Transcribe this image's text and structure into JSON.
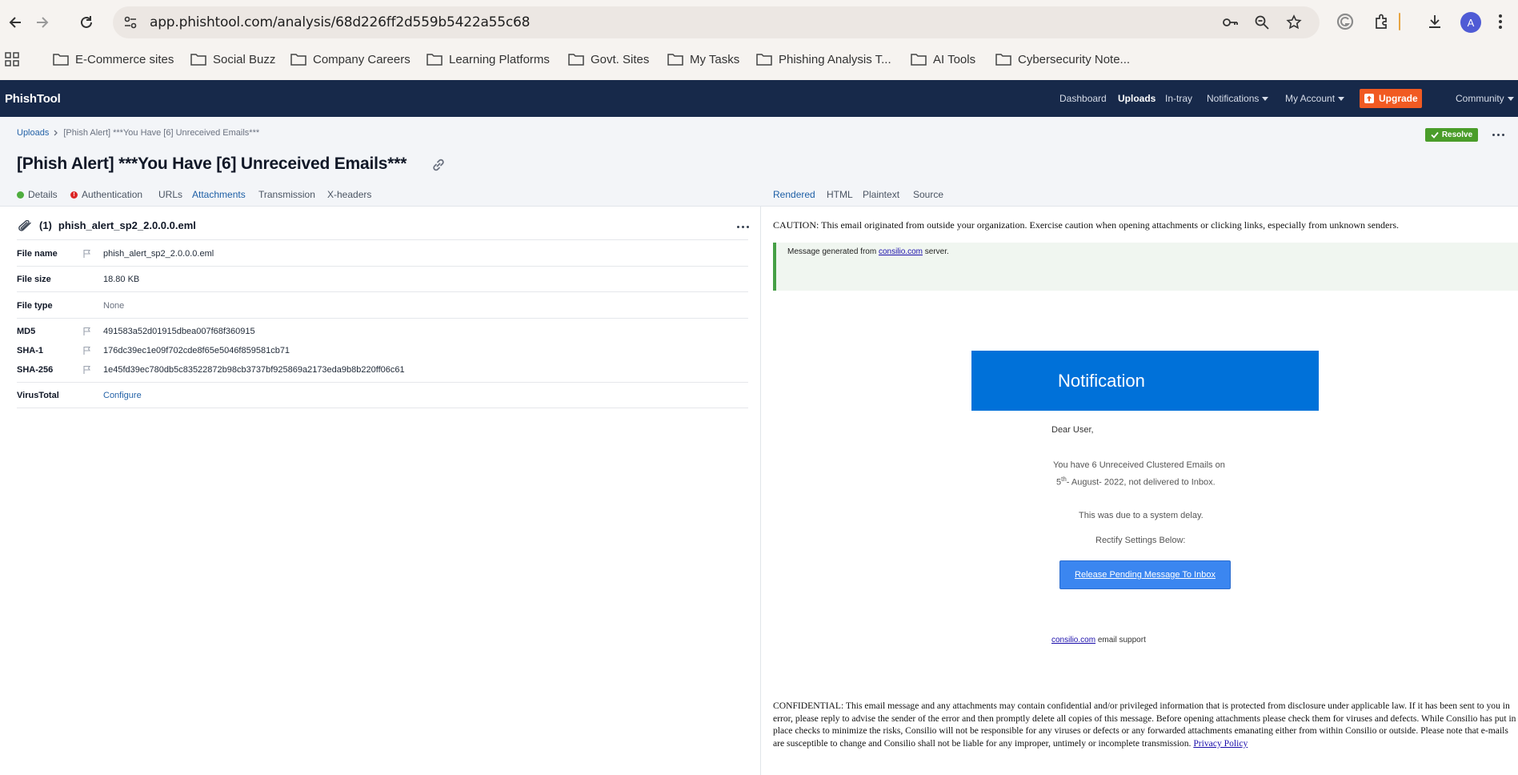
{
  "browser": {
    "url": "app.phishtool.com/analysis/68d226ff2d559b5422a55c68",
    "avatar_letter": "A",
    "bookmarks": [
      {
        "label": "E-Commerce sites"
      },
      {
        "label": "Social Buzz"
      },
      {
        "label": "Company Careers"
      },
      {
        "label": "Learning Platforms"
      },
      {
        "label": "Govt. Sites"
      },
      {
        "label": "My Tasks"
      },
      {
        "label": "Phishing Analysis T..."
      },
      {
        "label": "AI Tools"
      },
      {
        "label": "Cybersecurity Note..."
      }
    ]
  },
  "app": {
    "brand": "PhishTool",
    "nav": {
      "dashboard": "Dashboard",
      "uploads": "Uploads",
      "intray": "In-tray",
      "notifications": "Notifications",
      "account": "My Account",
      "upgrade": "Upgrade",
      "community": "Community"
    },
    "colors": {
      "header": "#17294a",
      "upgrade": "#f15a22",
      "resolve": "#4a9d2a",
      "accent": "#1d5fa6"
    }
  },
  "analysis": {
    "breadcrumb": {
      "root": "Uploads",
      "current": "[Phish Alert] ***You Have [6] Unreceived Emails***"
    },
    "title": "[Phish Alert] ***You Have [6] Unreceived Emails***",
    "resolve_label": "Resolve",
    "tabs_left": {
      "details": "Details",
      "authentication": "Authentication",
      "urls": "URLs",
      "attachments": "Attachments",
      "transmission": "Transmission",
      "xheaders": "X-headers"
    },
    "tabs_right": {
      "rendered": "Rendered",
      "html": "HTML",
      "plaintext": "Plaintext",
      "source": "Source"
    }
  },
  "attachment": {
    "index": "(1)",
    "name": "phish_alert_sp2_2.0.0.0.eml",
    "fields": {
      "file_name_label": "File name",
      "file_name": "phish_alert_sp2_2.0.0.0.eml",
      "file_size_label": "File size",
      "file_size": "18.80 KB",
      "file_type_label": "File type",
      "file_type": "None",
      "md5_label": "MD5",
      "md5": "491583a52d01915dbea007f68f360915",
      "sha1_label": "SHA-1",
      "sha1": "176dc39ec1e09f702cde8f65e5046f859581cb71",
      "sha256_label": "SHA-256",
      "sha256": "1e45fd39ec780db5c83522872b98cb3737bf925869a2173eda9b8b220ff06c61",
      "virustotal_label": "VirusTotal",
      "virustotal_action": "Configure"
    }
  },
  "email": {
    "caution": "CAUTION: This email originated from outside your organization. Exercise caution when opening attachments or clicking links, especially from unknown senders.",
    "generated_prefix": "Message generated from",
    "generated_link": "consilio.com",
    "generated_suffix": "server.",
    "banner": "Notification",
    "greeting": "Dear User,",
    "line1": "You have 6 Unreceived Clustered Emails on",
    "line2_day": "5",
    "line2_sup": "th",
    "line2_rest": "- August- 2022, not delivered to Inbox.",
    "line3": "This was due to a system delay.",
    "line4": "Rectify Settings Below:",
    "button": "Release Pending Message To Inbox",
    "support_link": "consilio.com",
    "support_text": "email support",
    "confidential": "CONFIDENTIAL: This email message and any attachments may contain confidential and/or privileged information that is protected from disclosure under applicable law. If it has been sent to you in error, please reply to advise the sender of the error and then promptly delete all copies of this message. Before opening attachments please check them for viruses and defects. While Consilio has put in place checks to minimize the risks, Consilio will not be responsible for any viruses or defects or any forwarded attachments emanating either from within Consilio or outside. Please note that e-mails are susceptible to change and Consilio shall not be liable for any improper, untimely or incomplete transmission.",
    "privacy": "Privacy Policy"
  }
}
